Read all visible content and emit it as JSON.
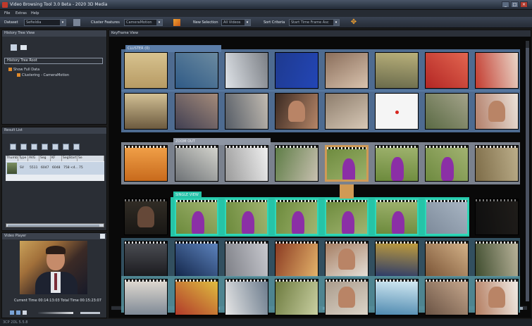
{
  "window": {
    "title": "Video Browsing Tool 3.0 Beta - 2020 3D Media",
    "buttons": [
      "_",
      "□",
      "×"
    ]
  },
  "menu": [
    "File",
    "Extras",
    "Help"
  ],
  "toolbar": {
    "dataset_label": "Dataset",
    "dataset_value": "Sefieldia",
    "cluster_features_label": "Cluster Features",
    "cluster_features_value": "CameraMotion",
    "new_selection_label": "New Selection",
    "new_selection_value": "All Videos",
    "sort_criteria_label": "Sort Criteria",
    "sort_criteria_value": "Start Time Frame Asc"
  },
  "history": {
    "header": "History Tree View",
    "root": "History Tree Root",
    "node1": "Show Full Data",
    "node2": "Clustering - CameraMotion"
  },
  "results": {
    "header": "Result List",
    "columns": [
      "Thumb",
      "Type",
      "AVG",
      "Seg",
      "KF",
      "SegStart",
      "Se"
    ],
    "row": [
      "",
      "SV",
      "5511",
      "6047",
      "6048",
      "758 <4...",
      "75"
    ]
  },
  "player": {
    "header": "Video Player",
    "time": "Current Time 00:14:13:03   Total Time 00:15:23:07"
  },
  "status": "3CP 2DL 5.5.8",
  "main": {
    "header": "KeyFrame View",
    "clusters": [
      {
        "label": "CLUSTER (0)",
        "color": "#5b7da8",
        "frames": [
          "sand",
          "guitar",
          "van",
          "blue",
          "crowd",
          "hall",
          "redmap",
          "redcar"
        ]
      },
      {
        "label": "",
        "color": "#5b7da8",
        "frames": [
          "door",
          "crowd2",
          "people",
          "man",
          "room",
          "reddot",
          "field",
          "women"
        ]
      },
      {
        "label": "ZOOM OUT",
        "color": "#8e96a4",
        "frames": [
          "orange",
          "phone",
          "wedding",
          "bike",
          "purple_sel",
          "purple",
          "purple2",
          "walk"
        ]
      },
      {
        "label": "SINGLE VIEW",
        "color": "#25c4a8",
        "frames": [
          "man2",
          "purple",
          "purple",
          "purple",
          "purple",
          "purple",
          "grey",
          "dark"
        ]
      },
      {
        "label": "",
        "color": "#3a5c6e",
        "frames": [
          "dark2",
          "screen",
          "phone2",
          "pizza",
          "hands",
          "uniform",
          "dog",
          "army"
        ]
      },
      {
        "label": "",
        "color": "#5b9aa8",
        "frames": [
          "kids",
          "flags",
          "sign",
          "greens",
          "talk",
          "ice",
          "crowd3",
          "bald"
        ]
      }
    ]
  }
}
